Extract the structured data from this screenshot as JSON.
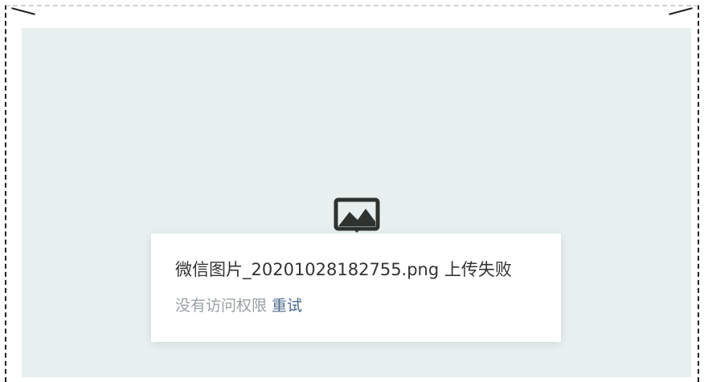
{
  "upload": {
    "icon": "image-placeholder-icon",
    "filename": "微信图片_20201028182755.png",
    "status": "上传失败",
    "reason": "没有访问权限",
    "retry_label": "重试"
  },
  "colors": {
    "canvas_bg": "#e7f0ef",
    "title_text": "#333333",
    "reason_text": "#9aa0a3",
    "retry_link": "#4d6a8c",
    "icon": "#2e3330"
  }
}
